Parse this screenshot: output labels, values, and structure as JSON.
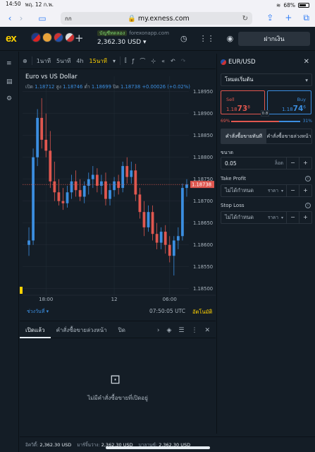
{
  "status_bar": {
    "time": "14:50",
    "date": "พฤ. 12 ก.พ.",
    "battery": "68%"
  },
  "browser": {
    "lang_badge": "กก",
    "url": "my.exness.com"
  },
  "app": {
    "logo": "ex",
    "account_label": "บัญชีทดลอง",
    "account_server": "forexonapp.com",
    "balance": "2,362.30 USD",
    "deposit_label": "ฝากเงิน"
  },
  "chart_toolbar": {
    "timeframes": [
      "1นาที",
      "5นาที",
      "4h",
      "15นาที"
    ],
    "active_timeframe": "15นาที"
  },
  "chart": {
    "title": "Euro vs US Dollar",
    "ohlc": {
      "open_label": "เปิด",
      "open": "1.18712",
      "high_label": "สูง",
      "high": "1.18746",
      "low_label": "ต่ำ",
      "low": "1.18699",
      "close_label": "ปิด",
      "close": "1.18738",
      "change": "+0.00026 (+0.02%)"
    },
    "range_label": "ช่วงวันที่",
    "clock": "07:50:05 UTC",
    "auto_label": "อัตโนมัติ"
  },
  "chart_data": {
    "type": "candlestick",
    "title": "Euro vs US Dollar",
    "y_ticks": [
      "1.18950",
      "1.18900",
      "1.18850",
      "1.18800",
      "1.18750",
      "1.18700",
      "1.18650",
      "1.18600",
      "1.18550",
      "1.18500"
    ],
    "ylim": [
      1.18485,
      1.18985
    ],
    "x_ticks": [
      {
        "label": "18:00",
        "index": 4
      },
      {
        "label": "12",
        "index": 20
      },
      {
        "label": "06:00",
        "index": 33
      }
    ],
    "current_price": "1.18738",
    "current_price_value": 1.18738,
    "up_color": "#3b8ee0",
    "down_color": "#e0574f",
    "candles": [
      {
        "o": 1.186,
        "h": 1.1864,
        "l": 1.18575,
        "c": 1.1861
      },
      {
        "o": 1.1861,
        "h": 1.1882,
        "l": 1.186,
        "c": 1.188
      },
      {
        "o": 1.188,
        "h": 1.1891,
        "l": 1.1878,
        "c": 1.1889
      },
      {
        "o": 1.1889,
        "h": 1.18935,
        "l": 1.1882,
        "c": 1.1884
      },
      {
        "o": 1.1884,
        "h": 1.189,
        "l": 1.188,
        "c": 1.18815
      },
      {
        "o": 1.18815,
        "h": 1.1886,
        "l": 1.1873,
        "c": 1.18745
      },
      {
        "o": 1.18745,
        "h": 1.1879,
        "l": 1.187,
        "c": 1.1872
      },
      {
        "o": 1.1872,
        "h": 1.1875,
        "l": 1.1869,
        "c": 1.187
      },
      {
        "o": 1.187,
        "h": 1.1873,
        "l": 1.1868,
        "c": 1.18695
      },
      {
        "o": 1.18695,
        "h": 1.18735,
        "l": 1.18685,
        "c": 1.1872
      },
      {
        "o": 1.1872,
        "h": 1.1876,
        "l": 1.18705,
        "c": 1.18745
      },
      {
        "o": 1.18745,
        "h": 1.1877,
        "l": 1.1871,
        "c": 1.18725
      },
      {
        "o": 1.18725,
        "h": 1.1875,
        "l": 1.187,
        "c": 1.1871
      },
      {
        "o": 1.1871,
        "h": 1.18745,
        "l": 1.18695,
        "c": 1.18735
      },
      {
        "o": 1.18735,
        "h": 1.18765,
        "l": 1.18715,
        "c": 1.1875
      },
      {
        "o": 1.1875,
        "h": 1.1878,
        "l": 1.1873,
        "c": 1.1876
      },
      {
        "o": 1.1876,
        "h": 1.18775,
        "l": 1.1872,
        "c": 1.18735
      },
      {
        "o": 1.18735,
        "h": 1.1876,
        "l": 1.18715,
        "c": 1.18745
      },
      {
        "o": 1.18745,
        "h": 1.18765,
        "l": 1.1869,
        "c": 1.18705
      },
      {
        "o": 1.18705,
        "h": 1.1874,
        "l": 1.1869,
        "c": 1.18725
      },
      {
        "o": 1.18725,
        "h": 1.18755,
        "l": 1.1871,
        "c": 1.18745
      },
      {
        "o": 1.18745,
        "h": 1.1876,
        "l": 1.18715,
        "c": 1.1873
      },
      {
        "o": 1.1873,
        "h": 1.1879,
        "l": 1.1872,
        "c": 1.1878
      },
      {
        "o": 1.1878,
        "h": 1.188,
        "l": 1.1874,
        "c": 1.18755
      },
      {
        "o": 1.18755,
        "h": 1.1879,
        "l": 1.1874,
        "c": 1.1877
      },
      {
        "o": 1.1877,
        "h": 1.18785,
        "l": 1.187,
        "c": 1.18715
      },
      {
        "o": 1.18715,
        "h": 1.1873,
        "l": 1.1866,
        "c": 1.18675
      },
      {
        "o": 1.18675,
        "h": 1.187,
        "l": 1.1862,
        "c": 1.1864
      },
      {
        "o": 1.1864,
        "h": 1.1869,
        "l": 1.1863,
        "c": 1.18675
      },
      {
        "o": 1.18675,
        "h": 1.1869,
        "l": 1.1861,
        "c": 1.18625
      },
      {
        "o": 1.18625,
        "h": 1.1865,
        "l": 1.1859,
        "c": 1.18605
      },
      {
        "o": 1.18605,
        "h": 1.1864,
        "l": 1.1859,
        "c": 1.1863
      },
      {
        "o": 1.1863,
        "h": 1.18645,
        "l": 1.1858,
        "c": 1.186
      },
      {
        "o": 1.186,
        "h": 1.1862,
        "l": 1.1856,
        "c": 1.18575
      },
      {
        "o": 1.18575,
        "h": 1.1862,
        "l": 1.1853,
        "c": 1.1861
      },
      {
        "o": 1.1861,
        "h": 1.1864,
        "l": 1.1859,
        "c": 1.1862
      },
      {
        "o": 1.1862,
        "h": 1.1874,
        "l": 1.1861,
        "c": 1.1873
      },
      {
        "o": 1.1873,
        "h": 1.1875,
        "l": 1.1871,
        "c": 1.18738
      }
    ]
  },
  "bottom_panel": {
    "tabs": [
      "เปิดแล้ว",
      "คำสั่งซื้อขายล่วงหน้า",
      "ปิด"
    ],
    "empty_text": "ไม่มีคำสั่งซื้อขายที่เปิดอยู่"
  },
  "order_panel": {
    "symbol": "EUR/USD",
    "mode": "โหมดเริ่มต้น",
    "sell_label": "Sell",
    "sell_price_prefix": "1.18",
    "sell_price_big": "73",
    "sell_price_sup": "8",
    "buy_label": "Buy",
    "buy_price_prefix": "1.18",
    "buy_price_big": "74",
    "buy_price_sup": "6",
    "spread": "0.8",
    "sentiment_sell": "69%",
    "sentiment_buy": "31%",
    "sentiment_sell_value": 69,
    "order_tabs": [
      "คำสั่งซื้อขายทันที",
      "คำสั่งซื้อขายล่วงหน้า"
    ],
    "volume_label": "ขนาด",
    "volume": "0.05",
    "volume_unit": "ล็อต",
    "take_profit_label": "Take Profit",
    "take_profit_value": "ไม่ได้กำหนด",
    "stop_loss_label": "Stop Loss",
    "stop_loss_value": "ไม่ได้กำหนด",
    "price_unit": "ราคา"
  },
  "footer": {
    "equity_label": "อิควิตี้:",
    "equity": "2,362.30 USD",
    "free_margin_label": "มาร์จิ้นว่าง:",
    "free_margin": "2,362.30 USD",
    "balance_label": "บาลานซ์:",
    "balance": "2,362.30 USD"
  },
  "colors": {
    "accent": "#ffd200",
    "sell": "#e0574f",
    "buy": "#3b8ee0",
    "background": "#141d26"
  }
}
